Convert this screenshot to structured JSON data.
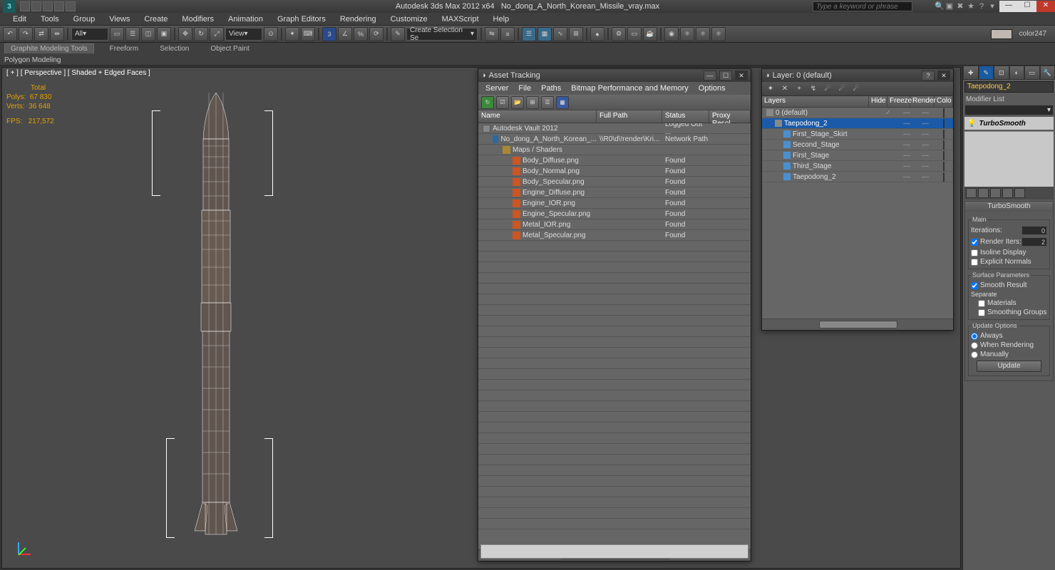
{
  "titlebar": {
    "app": "Autodesk 3ds Max 2012 x64",
    "file": "No_dong_A_North_Korean_Missile_vray.max",
    "search_placeholder": "Type a keyword or phrase"
  },
  "menu": {
    "items": [
      "Edit",
      "Tools",
      "Group",
      "Views",
      "Create",
      "Modifiers",
      "Animation",
      "Graph Editors",
      "Rendering",
      "Customize",
      "MAXScript",
      "Help"
    ]
  },
  "toolbar": {
    "combo_all": "All",
    "combo_view": "View",
    "combo_selset": "Create Selection Se",
    "swatch_name": "color247"
  },
  "ribbon": {
    "tabs": [
      "Graphite Modeling Tools",
      "Freeform",
      "Selection",
      "Object Paint"
    ],
    "sub": "Polygon Modeling"
  },
  "viewport": {
    "label": "[ + ] [ Perspective ] [ Shaded + Edged Faces ]",
    "total_label": "Total",
    "polys_label": "Polys:",
    "polys": "67 830",
    "verts_label": "Verts:",
    "verts": "36 648",
    "fps_label": "FPS:",
    "fps": "217,572"
  },
  "asset": {
    "title": "Asset Tracking",
    "menu": [
      "Server",
      "File",
      "Paths",
      "Bitmap Performance and Memory",
      "Options"
    ],
    "columns": {
      "name": "Name",
      "path": "Full Path",
      "status": "Status",
      "proxy": "Proxy Resol"
    },
    "rows": [
      {
        "indent": 0,
        "icon": "vault",
        "name": "Autodesk Vault 2012",
        "path": "",
        "status": "Logged Out ..."
      },
      {
        "indent": 1,
        "icon": "file",
        "name": "No_dong_A_North_Korean_...",
        "path": "\\\\R0\\d\\!render\\Kri...",
        "status": "Network Path"
      },
      {
        "indent": 2,
        "icon": "folder",
        "name": "Maps / Shaders",
        "path": "",
        "status": ""
      },
      {
        "indent": 3,
        "icon": "bmp",
        "name": "Body_Diffuse.png",
        "path": "",
        "status": "Found"
      },
      {
        "indent": 3,
        "icon": "bmp",
        "name": "Body_Normal.png",
        "path": "",
        "status": "Found"
      },
      {
        "indent": 3,
        "icon": "bmp",
        "name": "Body_Specular.png",
        "path": "",
        "status": "Found"
      },
      {
        "indent": 3,
        "icon": "bmp",
        "name": "Engine_Diffuse.png",
        "path": "",
        "status": "Found"
      },
      {
        "indent": 3,
        "icon": "bmp",
        "name": "Engine_IOR.png",
        "path": "",
        "status": "Found"
      },
      {
        "indent": 3,
        "icon": "bmp",
        "name": "Engine_Specular.png",
        "path": "",
        "status": "Found"
      },
      {
        "indent": 3,
        "icon": "bmp",
        "name": "Metal_IOR.png",
        "path": "",
        "status": "Found"
      },
      {
        "indent": 3,
        "icon": "bmp",
        "name": "Metal_Specular.png",
        "path": "",
        "status": "Found"
      }
    ]
  },
  "layers": {
    "title": "Layer: 0 (default)",
    "columns": {
      "layers": "Layers",
      "hide": "Hide",
      "freeze": "Freeze",
      "render": "Render",
      "color": "Colo"
    },
    "rows": [
      {
        "indent": 0,
        "icon": "layer",
        "name": "0 (default)",
        "sel": false,
        "color": "#888888",
        "check": true
      },
      {
        "indent": 1,
        "icon": "layersel",
        "name": "Taepodong_2",
        "sel": true,
        "color": "#ff8800",
        "check": false
      },
      {
        "indent": 2,
        "icon": "obj",
        "name": "First_Stage_Skirt",
        "sel": false,
        "color": "#888888",
        "check": false
      },
      {
        "indent": 2,
        "icon": "obj",
        "name": "Second_Stage",
        "sel": false,
        "color": "#888888",
        "check": false
      },
      {
        "indent": 2,
        "icon": "obj",
        "name": "First_Stage",
        "sel": false,
        "color": "#888888",
        "check": false
      },
      {
        "indent": 2,
        "icon": "obj",
        "name": "Third_Stage",
        "sel": false,
        "color": "#888888",
        "check": false
      },
      {
        "indent": 2,
        "icon": "obj",
        "name": "Taepodong_2",
        "sel": false,
        "color": "#888888",
        "check": false
      }
    ]
  },
  "cmd": {
    "objname": "Taepodong_2",
    "modlist_label": "Modifier List",
    "mod": "TurboSmooth",
    "rollout_title": "TurboSmooth",
    "main_label": "Main",
    "iter_label": "Iterations:",
    "iter": "0",
    "render_iter_label": "Render Iters:",
    "render_iter": "2",
    "isoline": "Isoline Display",
    "explicit": "Explicit Normals",
    "surf_label": "Surface Parameters",
    "smooth_result": "Smooth Result",
    "sep_label": "Separate",
    "materials": "Materials",
    "smgroups": "Smoothing Groups",
    "upd_label": "Update Options",
    "upd_always": "Always",
    "upd_render": "When Rendering",
    "upd_manual": "Manually",
    "upd_btn": "Update"
  }
}
